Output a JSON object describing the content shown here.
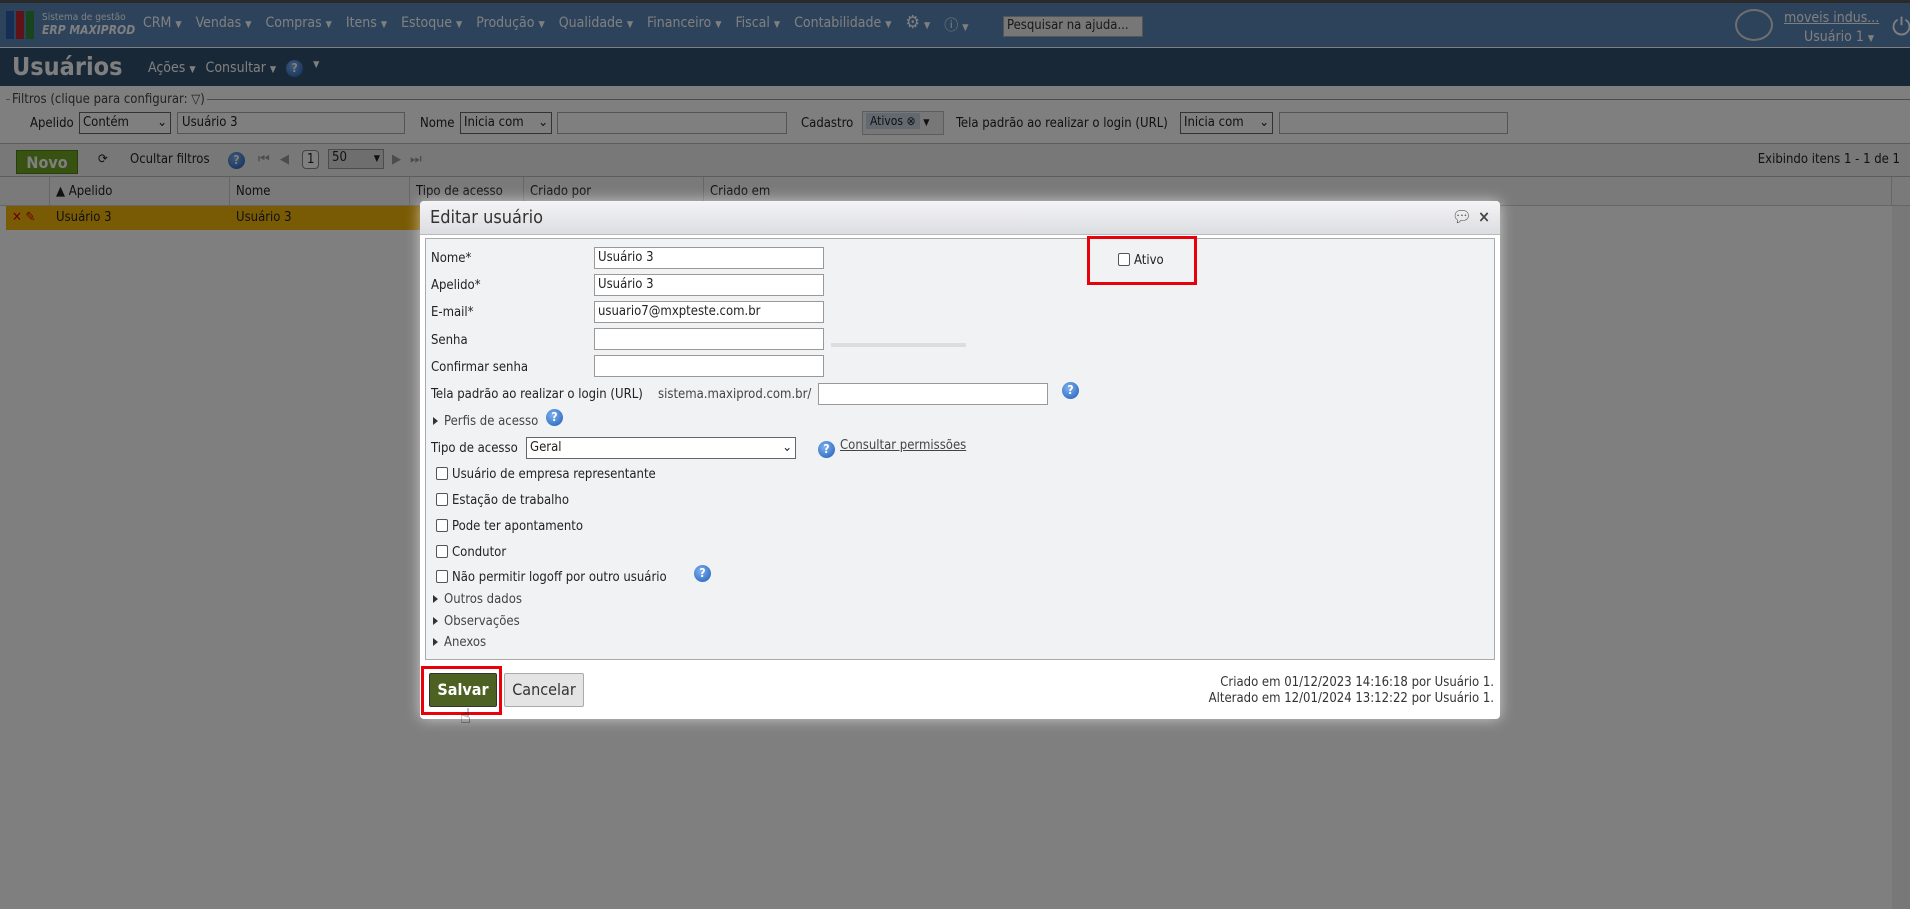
{
  "app": {
    "logo_line1": "Sistema de gestão",
    "logo_line2": "ERP MAXIPROD",
    "help_search_placeholder": "Pesquisar na ajuda...",
    "company": "moveis indus...",
    "user": "Usuário 1"
  },
  "menu": [
    "CRM",
    "Vendas",
    "Compras",
    "Itens",
    "Estoque",
    "Produção",
    "Qualidade",
    "Financeiro",
    "Fiscal",
    "Contabilidade"
  ],
  "page": {
    "title": "Usuários",
    "actions": "Ações",
    "consult": "Consultar"
  },
  "filters": {
    "legend": "Filtros (clique para configurar:",
    "apelido_label": "Apelido",
    "apelido_op": "Contém",
    "apelido_value": "Usuário 3",
    "nome_label": "Nome",
    "nome_op": "Inicia com",
    "cadastro_label": "Cadastro",
    "cadastro_chip": "Ativos",
    "url_label": "Tela padrão ao realizar o login (URL)",
    "url_op": "Inicia com"
  },
  "toolbar": {
    "new": "Novo",
    "hide_filters": "Ocultar filtros",
    "page": "1",
    "page_size": "50",
    "showing": "Exibindo itens 1 - 1 de 1"
  },
  "grid": {
    "columns": [
      "Apelido",
      "Nome",
      "Tipo de acesso",
      "Criado por",
      "Criado em"
    ],
    "rows": [
      {
        "apelido": "Usuário 3",
        "nome": "Usuário 3"
      }
    ]
  },
  "dialog": {
    "title": "Editar usuário",
    "nome_label": "Nome*",
    "nome": "Usuário 3",
    "apelido_label": "Apelido*",
    "apelido": "Usuário 3",
    "email_label": "E-mail*",
    "email": "usuario7@mxpteste.com.br",
    "senha_label": "Senha",
    "confirmar_label": "Confirmar senha",
    "url_label": "Tela padrão ao realizar o login (URL)",
    "url_prefix": "sistema.maxiprod.com.br/",
    "perfis": "Perfis de acesso",
    "tipo_label": "Tipo de acesso",
    "tipo": "Geral",
    "consultar": "Consultar permissões",
    "ativo": "Ativo",
    "checkboxes": [
      "Usuário de empresa representante",
      "Estação de trabalho",
      "Pode ter apontamento",
      "Condutor",
      "Não permitir logoff por outro usuário"
    ],
    "sections": [
      "Outros dados",
      "Observações",
      "Anexos"
    ],
    "save": "Salvar",
    "cancel": "Cancelar",
    "created": "Criado em 01/12/2023 14:16:18 por Usuário 1.",
    "modified": "Alterado em 12/01/2024 13:12:22 por Usuário 1."
  }
}
